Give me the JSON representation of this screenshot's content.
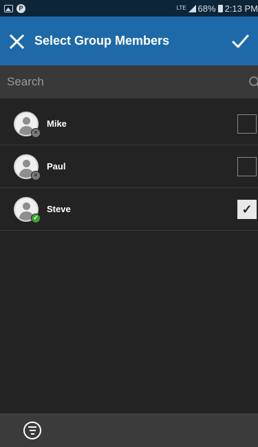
{
  "status_bar": {
    "network": "LTE",
    "battery": "68%",
    "time": "2:13 PM"
  },
  "header": {
    "title": "Select Group Members",
    "close_icon": "close-icon",
    "confirm_icon": "check-icon"
  },
  "search": {
    "placeholder": "Search",
    "value": ""
  },
  "members": [
    {
      "name": "Mike",
      "status": "offline",
      "checked": false
    },
    {
      "name": "Paul",
      "status": "offline",
      "checked": false
    },
    {
      "name": "Steve",
      "status": "online",
      "checked": true
    }
  ],
  "footer": {
    "filter_icon": "filter-icon"
  },
  "colors": {
    "status_bar": "#0c2538",
    "app_bar": "#1e6aa8",
    "background": "#232323",
    "search_bar": "#393939",
    "bottom_bar": "#3b3b3b",
    "online": "#3fa535"
  }
}
